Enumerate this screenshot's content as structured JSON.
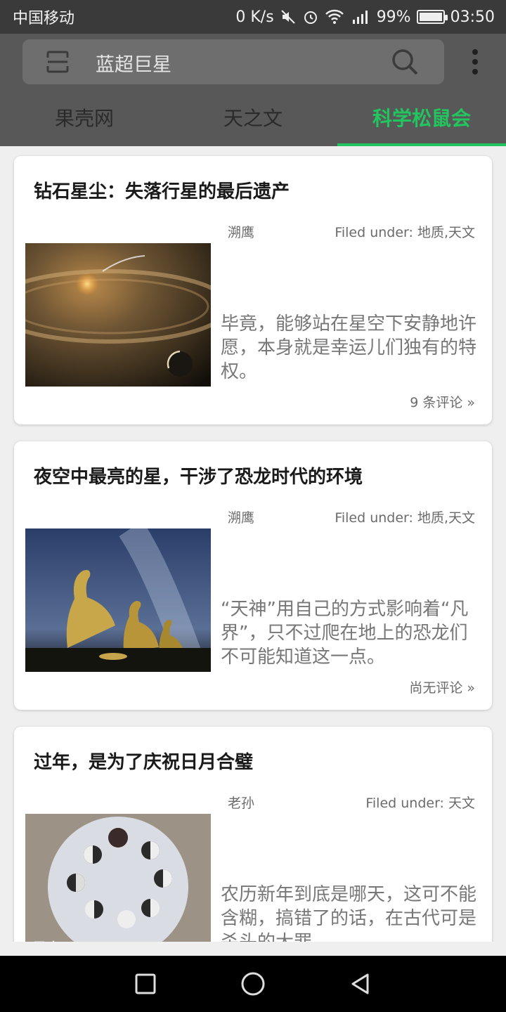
{
  "status_bar": {
    "carrier": "中国移动",
    "net_speed": "0 K/s",
    "signal": "4G",
    "battery": "99%",
    "battery_level": 0.99,
    "time": "03:50"
  },
  "search": {
    "query": "蓝超巨星"
  },
  "tabs": [
    {
      "label": "果壳网",
      "active": false
    },
    {
      "label": "天之文",
      "active": false
    },
    {
      "label": "科学松鼠会",
      "active": true
    }
  ],
  "colors": {
    "accent": "#22c55e",
    "header": "#585858"
  },
  "articles": [
    {
      "title": "钻石星尘：失落行星的最后遗产",
      "author": "溯鹰",
      "filed": "Filed under: 地质,天文",
      "excerpt": "毕竟，能够站在星空下安静地许愿，本身就是幸运儿们独有的特权。",
      "comments": "9 条评论 »",
      "image": "planetary-debris-ring"
    },
    {
      "title": "夜空中最亮的星，干涉了恐龙时代的环境",
      "author": "溯鹰",
      "filed": "Filed under: 地质,天文",
      "excerpt": "“天神”用自己的方式影响着“凡界”，只不过爬在地上的恐龙们不可能知道这一点。",
      "comments": "尚无评论 »",
      "image": "dinosaurs-under-milky-way"
    },
    {
      "title": "过年，是为了庆祝日月合璧",
      "author": "老孙",
      "filed": "Filed under: 天文",
      "excerpt": "农历新年到底是哪天，这可不能含糊，搞错了的话，在古代可是杀头的大罪",
      "comments": "",
      "image": "moon-phases-disc",
      "image_caption": "果壳"
    }
  ]
}
